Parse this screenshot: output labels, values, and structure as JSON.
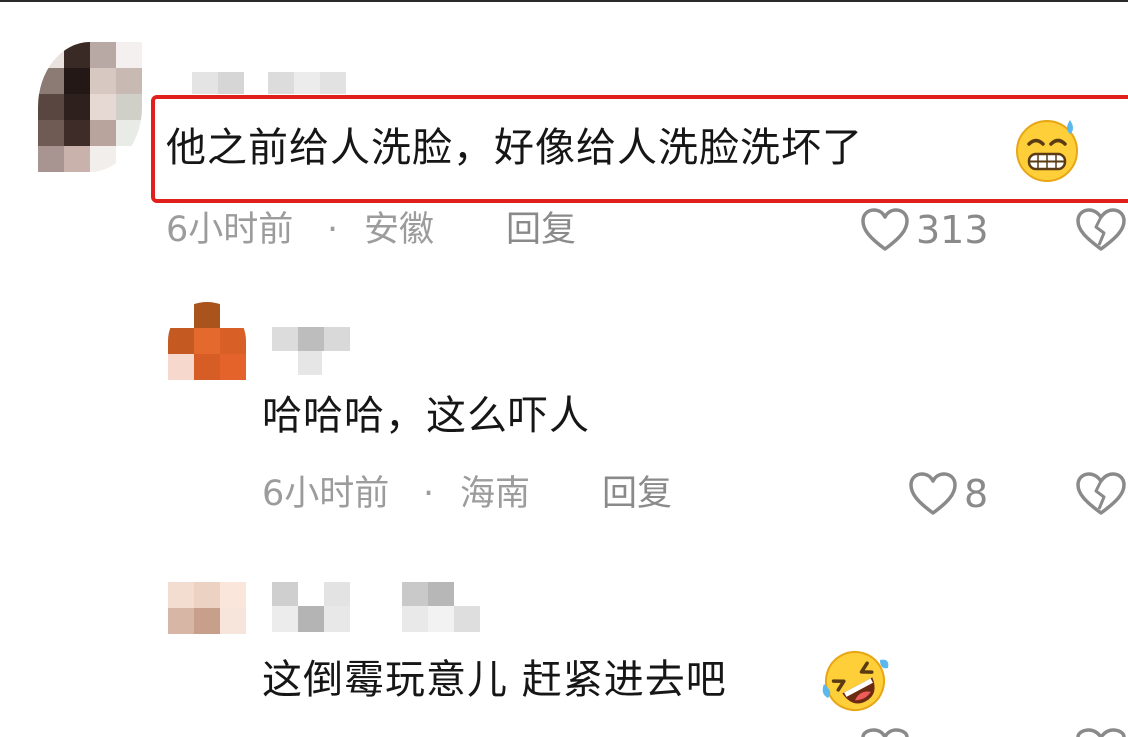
{
  "comments": [
    {
      "text": "他之前给人洗脸，好像给人洗脸洗坏了",
      "time": "6小时前",
      "dot": "·",
      "location": "安徽",
      "reply": "回复",
      "likes": "313",
      "emoji": "grimacing-sweat-face-icon"
    },
    {
      "text": "哈哈哈，这么吓人",
      "time": "6小时前",
      "dot": "·",
      "location": "海南",
      "reply": "回复",
      "likes": "8"
    },
    {
      "text": "这倒霉玩意儿 赶紧进去吧",
      "emoji": "rolling-laughing-face-icon"
    }
  ],
  "colors": {
    "highlight": "#e0201c",
    "meta": "#9c9c9c",
    "text": "#161616"
  }
}
